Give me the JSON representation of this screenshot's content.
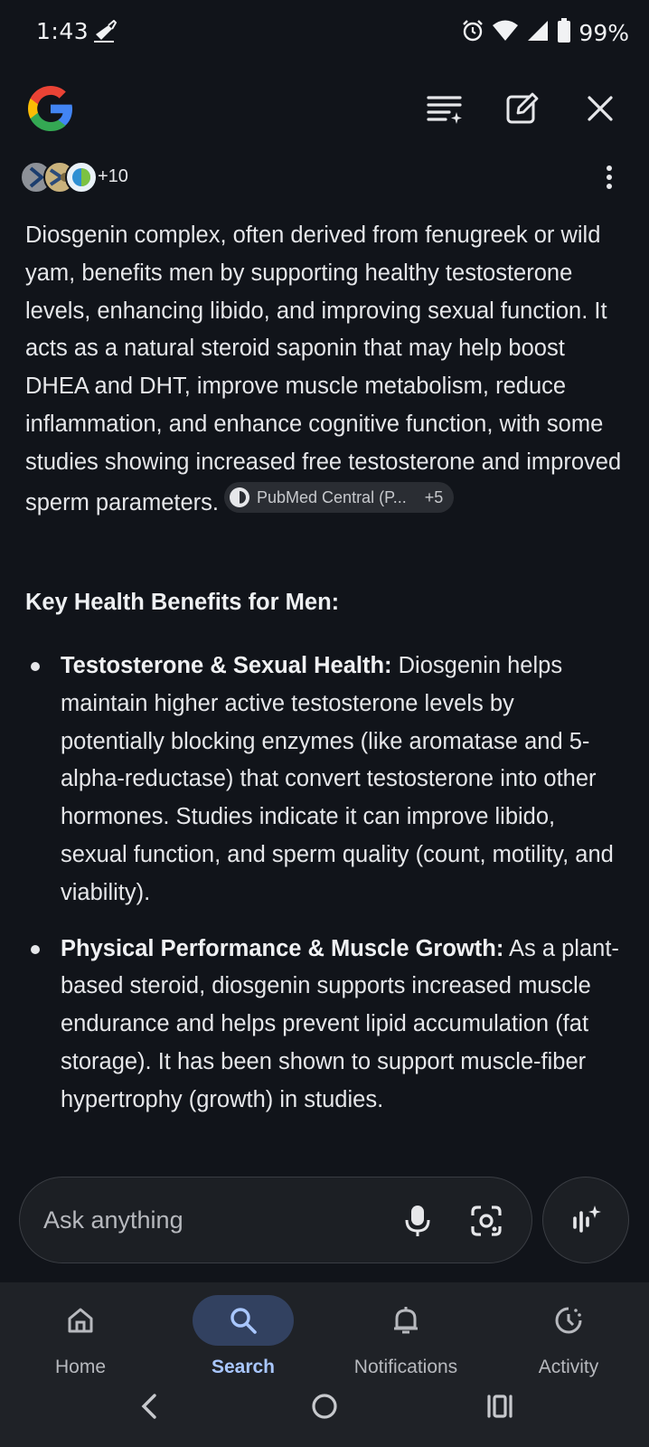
{
  "status_bar": {
    "time": "1:43",
    "battery": "99%"
  },
  "sources": {
    "count_label": "+10"
  },
  "answer": {
    "paragraph": "Diosgenin complex, often derived from fenugreek or wild yam, benefits men by supporting healthy testosterone levels, enhancing libido, and improving sexual function. It acts as a natural steroid saponin that may help boost DHEA and DHT, improve muscle metabolism, reduce inflammation, and enhance cognitive function, with some studies showing increased free testosterone and improved sperm parameters.",
    "citation_label": "PubMed Central (P...",
    "citation_more": "+5",
    "heading": "Key Health Benefits for Men:",
    "bullets": [
      {
        "title": "Testosterone & Sexual Health:",
        "text": " Diosgenin helps maintain higher active testosterone levels by potentially blocking enzymes (like aromatase and 5-alpha-reductase) that convert testosterone into other hormones. Studies indicate it can improve libido, sexual function, and sperm quality (count, motility, and viability)."
      },
      {
        "title": "Physical Performance & Muscle Growth:",
        "text": " As a plant-based steroid, diosgenin supports increased muscle endurance and helps prevent lipid accumulation (fat storage). It has been shown to support muscle-fiber hypertrophy (growth) in studies."
      }
    ]
  },
  "ask": {
    "placeholder": "Ask anything"
  },
  "nav": {
    "items": [
      {
        "label": "Home",
        "icon": "home-icon"
      },
      {
        "label": "Search",
        "icon": "search-icon",
        "active": true
      },
      {
        "label": "Notifications",
        "icon": "bell-icon"
      },
      {
        "label": "Activity",
        "icon": "activity-icon"
      }
    ]
  },
  "colors": {
    "background": "#11141a",
    "active_accent": "#a9c7ff",
    "active_pill": "#324160"
  }
}
